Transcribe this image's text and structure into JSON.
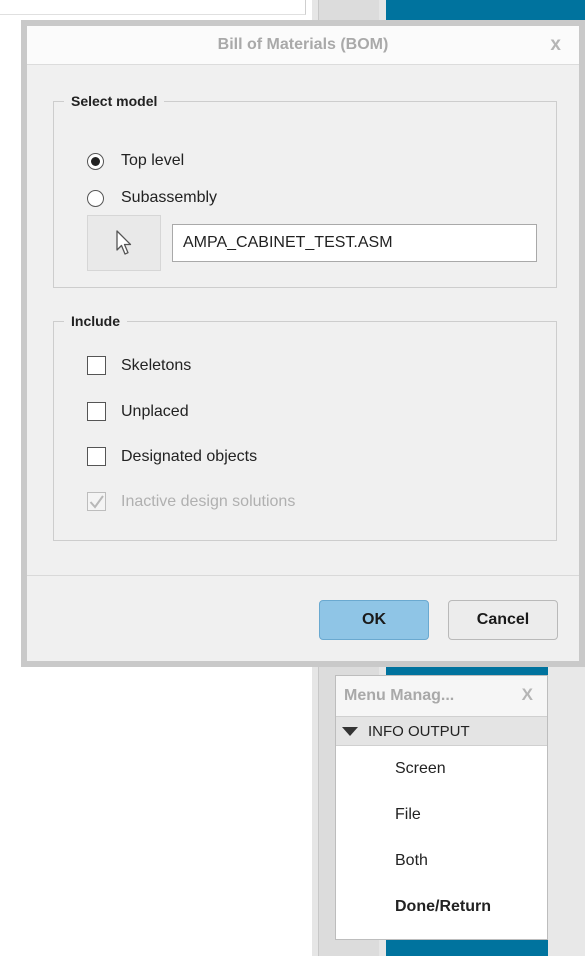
{
  "dialog": {
    "title": "Bill of Materials (BOM)",
    "close_glyph": "x",
    "select_model": {
      "legend": "Select model",
      "top_level_label": "Top level",
      "subassembly_label": "Subassembly",
      "selected": "Top level",
      "model_name": "AMPA_CABINET_TEST.ASM",
      "pick_icon": "cursor-arrow-icon"
    },
    "include": {
      "legend": "Include",
      "skeletons_label": "Skeletons",
      "unplaced_label": "Unplaced",
      "designated_label": "Designated objects",
      "inactive_label": "Inactive design solutions"
    },
    "ok_label": "OK",
    "cancel_label": "Cancel"
  },
  "menu_manager": {
    "title": "Menu Manag...",
    "close_glyph": "X",
    "header": "INFO OUTPUT",
    "items": [
      "Screen",
      "File",
      "Both",
      "Done/Return"
    ]
  },
  "colors": {
    "accent_bg": "#00739e",
    "ok_button": "#8fc5e6"
  }
}
